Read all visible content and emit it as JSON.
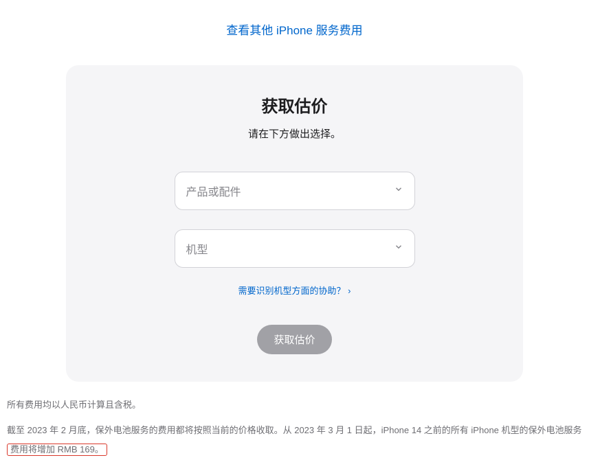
{
  "topLink": "查看其他 iPhone 服务费用",
  "card": {
    "title": "获取估价",
    "subtitle": "请在下方做出选择。",
    "select1Placeholder": "产品或配件",
    "select2Placeholder": "机型",
    "helpLinkText": "需要识别机型方面的协助？",
    "helpLinkArrow": "›",
    "submitLabel": "获取估价"
  },
  "footer": {
    "line1": "所有费用均以人民币计算且含税。",
    "line2_a": "截至 2023 年 2 月底，保外电池服务的费用都将按照当前的价格收取。从 2023 年 3 月 1 日起，iPhone 14 之前的所有 iPhone 机型的保外电池服务",
    "line2_b": "费用将增加 RMB 169。"
  }
}
